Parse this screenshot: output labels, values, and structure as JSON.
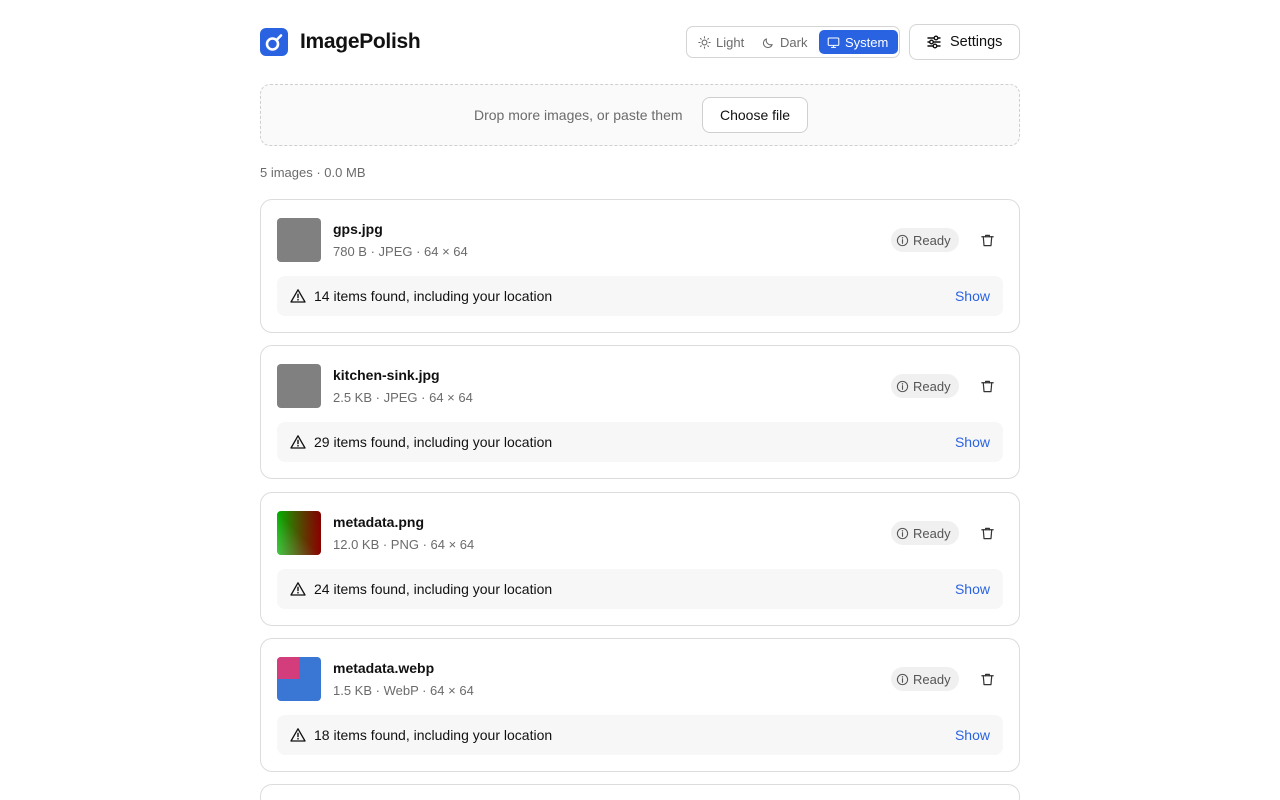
{
  "app": {
    "name": "ImagePolish",
    "logo_icon": "logo-icon"
  },
  "theme": {
    "options": [
      {
        "label": "Light",
        "icon": "sun-icon"
      },
      {
        "label": "Dark",
        "icon": "moon-icon"
      },
      {
        "label": "System",
        "icon": "monitor-icon"
      }
    ],
    "selected": "System",
    "accent_color": "#2a63e2"
  },
  "settings": {
    "label": "Settings",
    "icon": "sliders-icon"
  },
  "dropzone": {
    "text": "Drop more images, or paste them",
    "button_label": "Choose file"
  },
  "summary": "5 images · 0.0 MB",
  "files": [
    {
      "name": "gps.jpg",
      "meta": "780 B · JPEG · 64 × 64",
      "status": "Ready",
      "finding": "14 items found, including your location",
      "action": "Show"
    },
    {
      "name": "kitchen-sink.jpg",
      "meta": "2.5 KB · JPEG · 64 × 64",
      "status": "Ready",
      "finding": "29 items found, including your location",
      "action": "Show"
    },
    {
      "name": "metadata.png",
      "meta": "12.0 KB · PNG · 64 × 64",
      "status": "Ready",
      "finding": "24 items found, including your location",
      "action": "Show"
    },
    {
      "name": "metadata.webp",
      "meta": "1.5 KB · WebP · 64 × 64",
      "status": "Ready",
      "finding": "18 items found, including your location",
      "action": "Show"
    }
  ]
}
